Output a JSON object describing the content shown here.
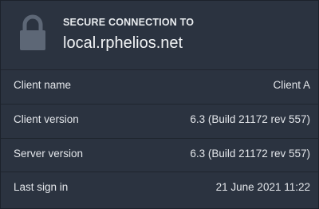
{
  "header": {
    "icon": "lock-icon",
    "caption": "SECURE CONNECTION TO",
    "host": "local.rphelios.net"
  },
  "details": [
    {
      "label": "Client name",
      "value": "Client A"
    },
    {
      "label": "Client version",
      "value": "6.3 (Build 21172 rev 557)"
    },
    {
      "label": "Server version",
      "value": "6.3 (Build 21172 rev 557)"
    },
    {
      "label": "Last sign in",
      "value": "21 June 2021 11:22"
    }
  ],
  "colors": {
    "panel_background": "#2b3340",
    "text": "#e8eaed",
    "icon": "#5d6776"
  }
}
